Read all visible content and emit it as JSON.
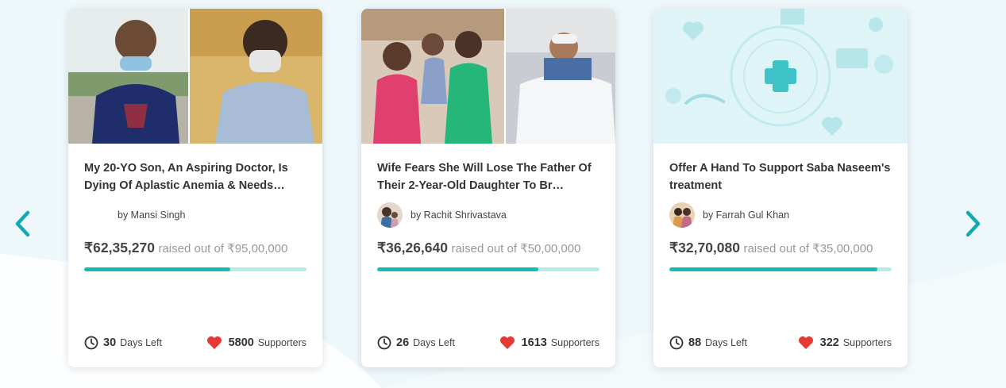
{
  "carousel": {
    "prev_icon": "chevron-left-icon",
    "next_icon": "chevron-right-icon",
    "accent_color": "#12bdb4"
  },
  "cards": [
    {
      "title": "My 20-YO Son, An Aspiring Doctor, Is Dying Of Aplastic Anemia & Needs…",
      "author": "by Mansi Singh",
      "raised": "₹62,35,270",
      "goal_text": "raised out of ₹95,00,000",
      "progress": 0.656,
      "days_left": "30",
      "days_label": "Days Left",
      "supporters": "5800",
      "supporters_label": "Supporters"
    },
    {
      "title": "Wife Fears She Will Lose The Father Of Their 2-Year-Old Daughter To Br…",
      "author": "by Rachit Shrivastava",
      "raised": "₹36,26,640",
      "goal_text": "raised out of ₹50,00,000",
      "progress": 0.725,
      "days_left": "26",
      "days_label": "Days Left",
      "supporters": "1613",
      "supporters_label": "Supporters"
    },
    {
      "title": "Offer A Hand To Support Saba Naseem's treatment",
      "author": "by Farrah Gul Khan",
      "raised": "₹32,70,080",
      "goal_text": "raised out of ₹35,00,000",
      "progress": 0.934,
      "days_left": "88",
      "days_label": "Days Left",
      "supporters": "322",
      "supporters_label": "Supporters"
    }
  ]
}
